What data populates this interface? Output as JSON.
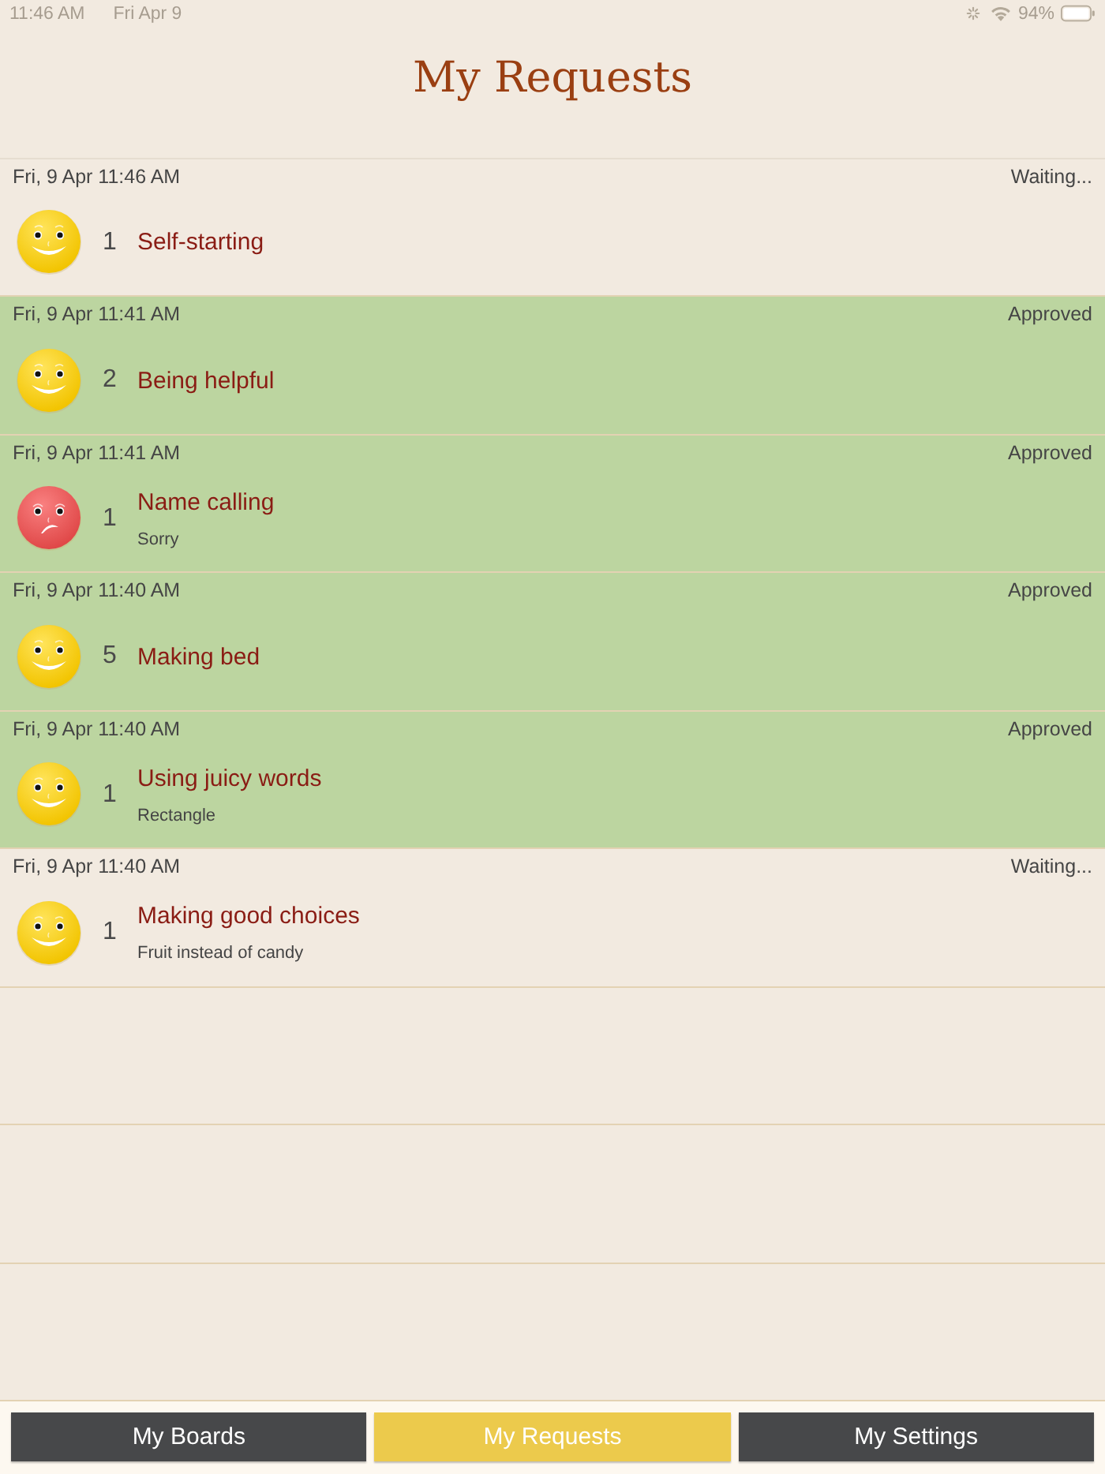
{
  "status_bar": {
    "time": "11:46 AM",
    "date": "Fri Apr 9",
    "battery": "94%"
  },
  "header": {
    "title": "My Requests"
  },
  "requests": [
    {
      "date": "Fri, 9 Apr 11:46 AM",
      "status": "Waiting...",
      "approved": false,
      "kind": "happy",
      "count": "1",
      "title": "Self-starting"
    },
    {
      "date": "Fri, 9 Apr 11:41 AM",
      "status": "Approved",
      "approved": true,
      "kind": "happy",
      "count": "2",
      "title": "Being helpful"
    },
    {
      "date": "Fri, 9 Apr 11:41 AM",
      "status": "Approved",
      "approved": true,
      "kind": "sad",
      "count": "1",
      "title": "Name calling",
      "note": "Sorry"
    },
    {
      "date": "Fri, 9 Apr 11:40 AM",
      "status": "Approved",
      "approved": true,
      "kind": "happy",
      "count": "5",
      "title": "Making bed"
    },
    {
      "date": "Fri, 9 Apr 11:40 AM",
      "status": "Approved",
      "approved": true,
      "kind": "happy",
      "count": "1",
      "title": "Using juicy words",
      "note": "Rectangle"
    },
    {
      "date": "Fri, 9 Apr 11:40 AM",
      "status": "Waiting...",
      "approved": false,
      "kind": "happy",
      "count": "1",
      "title": "Making good choices",
      "note": "Fruit instead of candy"
    }
  ],
  "tabs": [
    {
      "label": "My Boards",
      "selected": false
    },
    {
      "label": "My Requests",
      "selected": true
    },
    {
      "label": "My Settings",
      "selected": false
    }
  ]
}
